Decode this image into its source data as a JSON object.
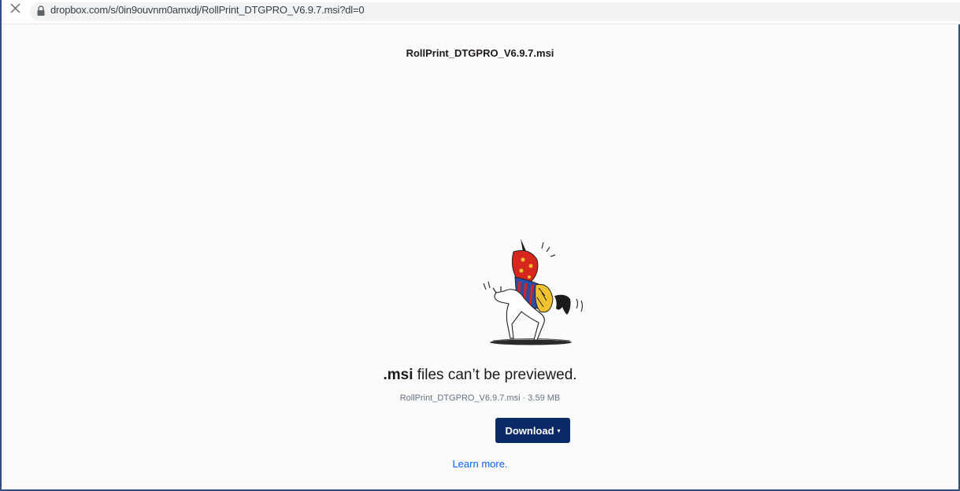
{
  "browser": {
    "url": "dropbox.com/s/0in9ouvnm0amxdj/RollPrint_DTGPRO_V6.9.7.msi?dl=0",
    "close_icon": "close-icon",
    "lock_icon": "lock-icon"
  },
  "preview": {
    "file_title": "RollPrint_DTGPRO_V6.9.7.msi",
    "illustration": "unicorn-illustration",
    "headline_ext": ".msi",
    "headline_rest": " files can’t be previewed.",
    "file_meta": "RollPrint_DTGPRO_V6.9.7.msi · 3.59 MB",
    "download_label": "Download",
    "download_caret": "▾",
    "learn_more": "Learn more."
  },
  "colors": {
    "button_bg": "#0a2a66",
    "link": "#0061fe",
    "frame_border": "#2f4f7f"
  }
}
